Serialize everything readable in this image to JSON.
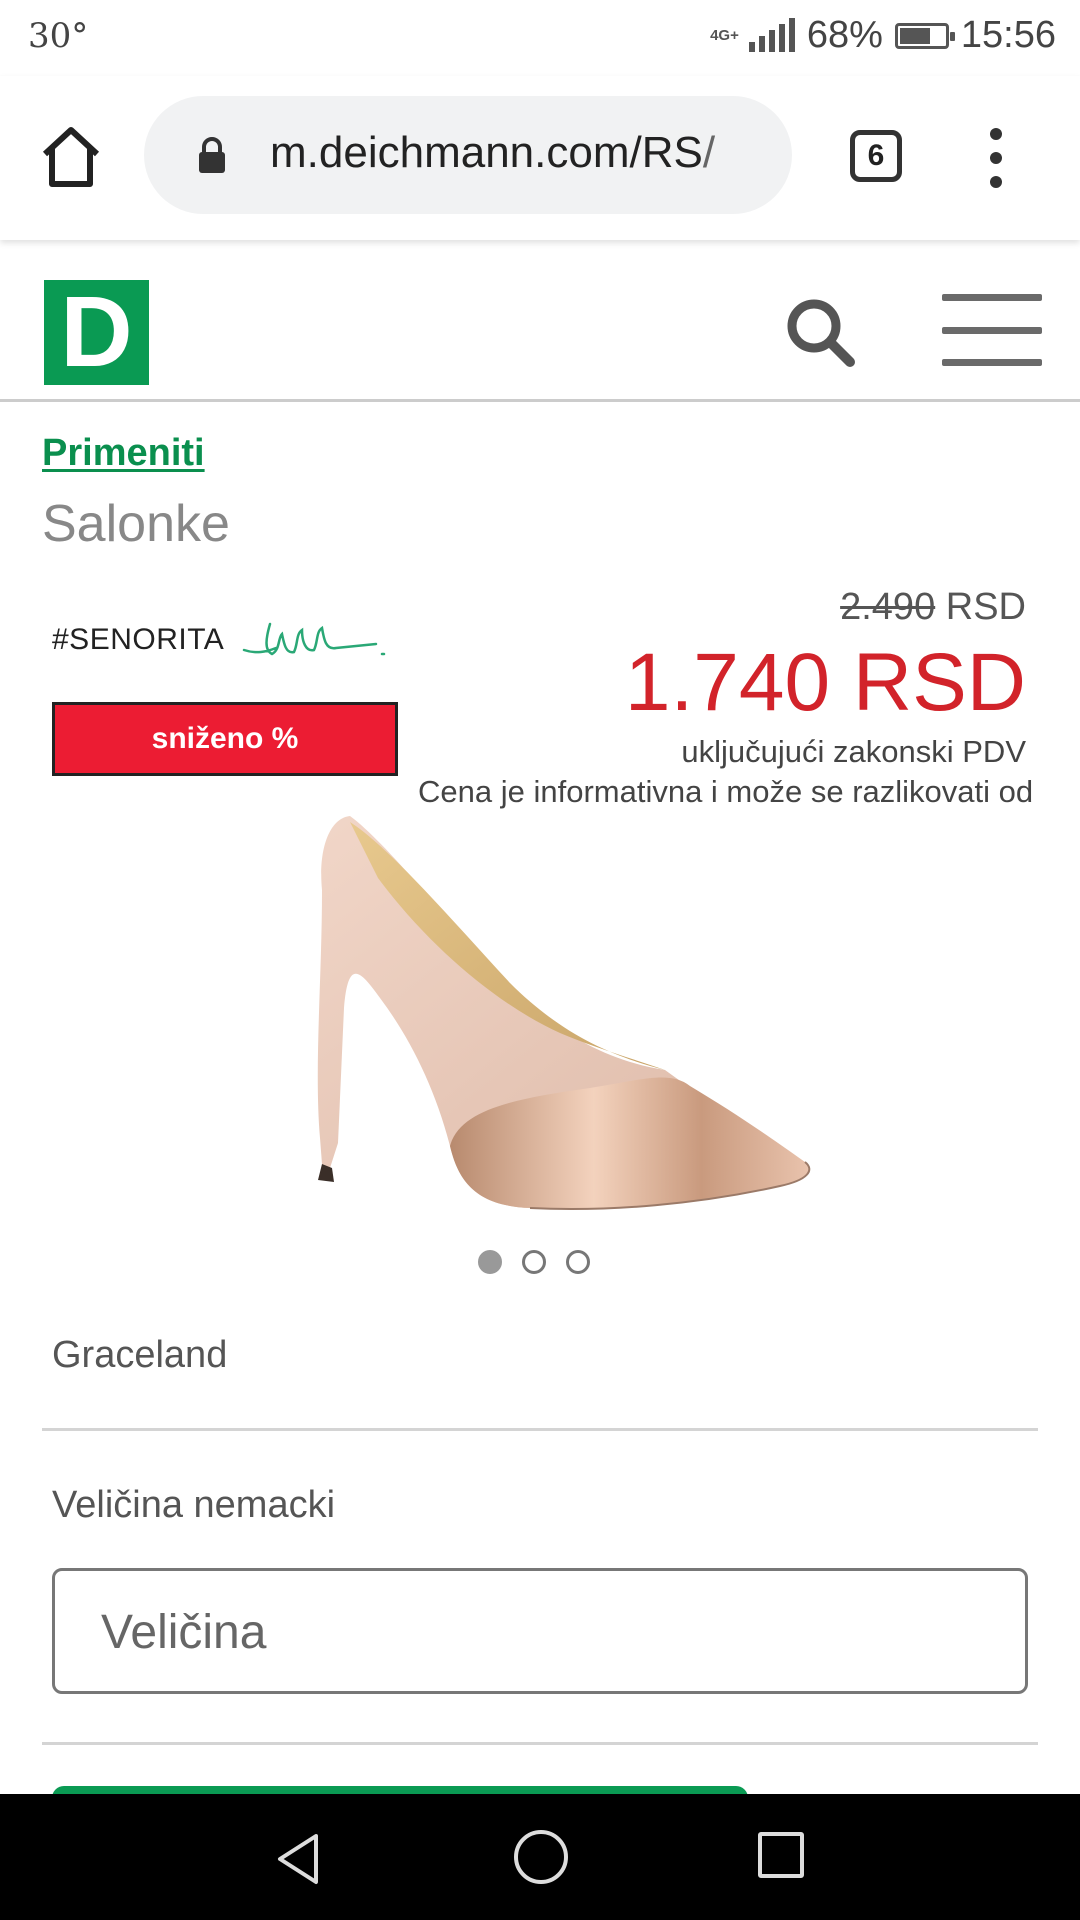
{
  "status_bar": {
    "temperature": "30°",
    "network": "4G+",
    "battery": "68%",
    "battery_level": 0.68,
    "time": "15:56"
  },
  "browser": {
    "url_main": "m.deichmann.com/RS",
    "url_tail": "/",
    "tab_count": "6",
    "icons": [
      "home-icon",
      "lock-icon",
      "tabs-icon",
      "more-vert-icon"
    ]
  },
  "site_header": {
    "logo_letter": "D",
    "icons": [
      "search-icon",
      "hamburger-menu-icon"
    ]
  },
  "product": {
    "brand_link": "Primeniti",
    "category": "Salonke",
    "tag": "#SENORITA",
    "sale_badge": "sniženo %",
    "old_price_value": "2.490",
    "old_price_currency": "RSD",
    "new_price": "1.740 RSD",
    "vat_note": "uključujući zakonski PDV",
    "info_note": "Cena je informativna i može se razlikovati od",
    "manufacturer": "Graceland",
    "carousel": {
      "count": 3,
      "active": 0
    }
  },
  "size_section": {
    "label": "Veličina nemacki",
    "placeholder": "Veličina"
  },
  "colors": {
    "brand_green": "#0a9a53",
    "sale_red": "#ec1c33",
    "price_red": "#d2232a"
  }
}
